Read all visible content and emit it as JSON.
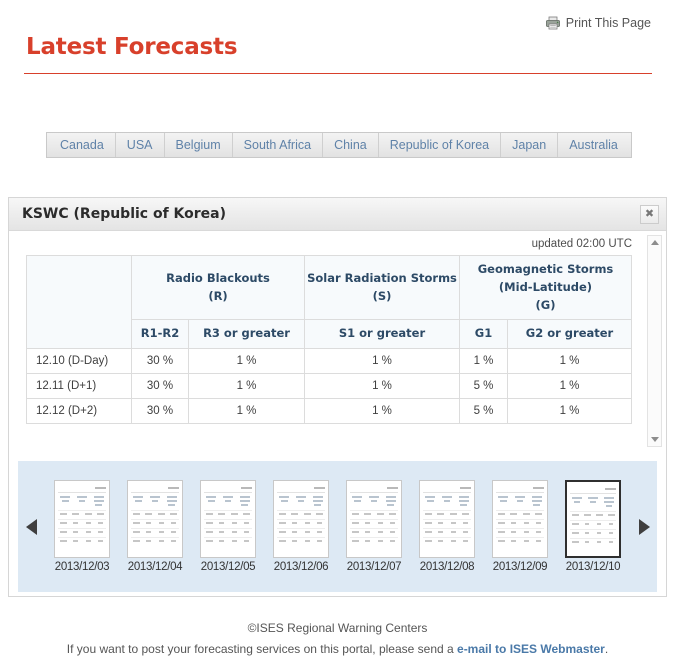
{
  "header": {
    "print_label": "Print This Page",
    "print_icon": "printer-icon",
    "page_title": "Latest Forecasts",
    "title_color": "#d8402b"
  },
  "tabs": [
    {
      "label": "Canada",
      "active": false
    },
    {
      "label": "USA",
      "active": false
    },
    {
      "label": "Belgium",
      "active": false
    },
    {
      "label": "South Africa",
      "active": false
    },
    {
      "label": "China",
      "active": false
    },
    {
      "label": "Republic of Korea",
      "active": true
    },
    {
      "label": "Japan",
      "active": false
    },
    {
      "label": "Australia",
      "active": false
    }
  ],
  "panel": {
    "title": "KSWC (Republic of Korea)",
    "close_icon": "close-icon",
    "close_label": "✖",
    "updated": "updated 02:00 UTC",
    "scroll_up_icon": "scroll-up-arrow-icon",
    "scroll_down_icon": "scroll-down-arrow-icon"
  },
  "table": {
    "group_headers": [
      {
        "line1": "Radio Blackouts",
        "line2": "(R)",
        "line3": ""
      },
      {
        "line1": "Solar Radiation Storms",
        "line2": "(S)",
        "line3": ""
      },
      {
        "line1": "Geomagnetic Storms",
        "line2": "(Mid-Latitude)",
        "line3": "(G)"
      }
    ],
    "sub_headers": [
      "R1-R2",
      "R3 or greater",
      "S1 or greater",
      "G1",
      "G2 or greater"
    ],
    "rows": [
      {
        "day": "12.10 (D-Day)",
        "values": [
          "30 %",
          "1 %",
          "1 %",
          "1 %",
          "1 %"
        ]
      },
      {
        "day": "12.11 (D+1)",
        "values": [
          "30 %",
          "1 %",
          "1 %",
          "5 %",
          "1 %"
        ]
      },
      {
        "day": "12.12 (D+2)",
        "values": [
          "30 %",
          "1 %",
          "1 %",
          "5 %",
          "1 %"
        ]
      }
    ]
  },
  "carousel": {
    "prev_icon": "carousel-prev-arrow-icon",
    "next_icon": "carousel-next-arrow-icon",
    "background_color": "#dde9f4",
    "thumbs": [
      {
        "date": "2013/12/03",
        "selected": false
      },
      {
        "date": "2013/12/04",
        "selected": false
      },
      {
        "date": "2013/12/05",
        "selected": false
      },
      {
        "date": "2013/12/06",
        "selected": false
      },
      {
        "date": "2013/12/07",
        "selected": false
      },
      {
        "date": "2013/12/08",
        "selected": false
      },
      {
        "date": "2013/12/09",
        "selected": false
      },
      {
        "date": "2013/12/10",
        "selected": true
      }
    ]
  },
  "footer": {
    "copyright": "©ISES Regional Warning Centers",
    "note_prefix": "If you want to post your forecasting services on this portal, please send a ",
    "link_text": "e-mail to ISES Webmaster",
    "note_suffix": ".",
    "link_color": "#4a79a8"
  }
}
